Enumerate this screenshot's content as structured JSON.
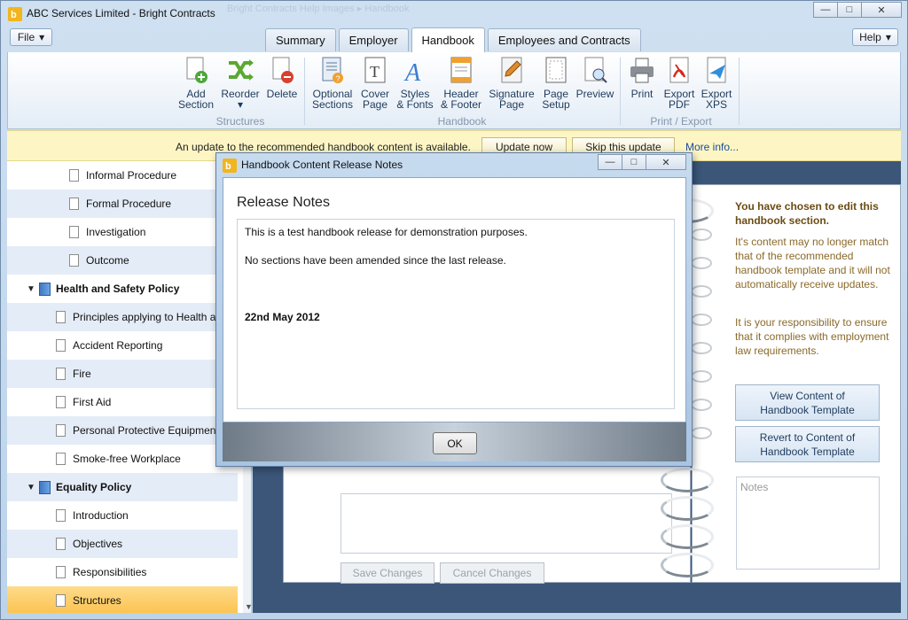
{
  "window": {
    "title": "ABC Services Limited - Bright Contracts",
    "ghost_text": "Bright Contracts Help Images  ▸  Handbook",
    "minimize": "—",
    "maximize": "□",
    "close": "✕"
  },
  "menubar": {
    "file_label": "File",
    "help_label": "Help",
    "dropdown_glyph": "▾"
  },
  "tabs": [
    {
      "label": "Summary",
      "active": false
    },
    {
      "label": "Employer",
      "active": false
    },
    {
      "label": "Handbook",
      "active": true
    },
    {
      "label": "Employees and Contracts",
      "active": false
    }
  ],
  "ribbon": {
    "structures": {
      "label": "Structures",
      "add_section": [
        "Add",
        "Section"
      ],
      "reorder": [
        "Reorder",
        "▾"
      ],
      "delete": "Delete"
    },
    "handbook": {
      "label": "Handbook",
      "optional_sections": [
        "Optional",
        "Sections"
      ],
      "cover_page": [
        "Cover",
        "Page"
      ],
      "styles_fonts": [
        "Styles",
        "& Fonts"
      ],
      "header_footer": [
        "Header",
        "& Footer"
      ],
      "signature_page": [
        "Signature",
        "Page"
      ],
      "page_setup": [
        "Page",
        "Setup"
      ],
      "preview": "Preview"
    },
    "print_export": {
      "label": "Print / Export",
      "print": "Print",
      "export_pdf": [
        "Export",
        "PDF"
      ],
      "export_xps": [
        "Export",
        "XPS"
      ]
    }
  },
  "notification": {
    "text": "An update to the recommended handbook content is available.",
    "update_now": "Update now",
    "skip_update": "Skip this update",
    "more_info": "More info..."
  },
  "sidebar": {
    "items": [
      {
        "label": "Informal Procedure",
        "level": 2
      },
      {
        "label": "Formal Procedure",
        "level": 2
      },
      {
        "label": "Investigation",
        "level": 2
      },
      {
        "label": "Outcome",
        "level": 2
      },
      {
        "label": "Health and Safety Policy",
        "level": 0
      },
      {
        "label": "Principles applying to Health and Safety",
        "level": 1
      },
      {
        "label": "Accident Reporting",
        "level": 1
      },
      {
        "label": "Fire",
        "level": 1
      },
      {
        "label": "First Aid",
        "level": 1
      },
      {
        "label": "Personal Protective Equipment",
        "level": 1
      },
      {
        "label": "Smoke-free Workplace",
        "level": 1
      },
      {
        "label": "Equality Policy",
        "level": 0
      },
      {
        "label": "Introduction",
        "level": 1
      },
      {
        "label": "Objectives",
        "level": 1
      },
      {
        "label": "Responsibilities",
        "level": 1
      },
      {
        "label": "Structures",
        "level": 1,
        "selected": true
      }
    ],
    "expand_glyph": "▼",
    "scroll_down_glyph": "▼"
  },
  "editor": {
    "save_changes": "Save Changes",
    "cancel_changes": "Cancel Changes"
  },
  "info_panel": {
    "heading": "You have chosen to edit this handbook section.",
    "para1": "It's content may no longer match that of the recommended handbook template and it will not automatically receive updates.",
    "para2": "It is your responsibility to ensure that it complies with employment law requirements.",
    "view_button": [
      "View Content of",
      "Handbook Template"
    ],
    "revert_button": [
      "Revert to Content of",
      "Handbook Template"
    ],
    "notes_placeholder": "Notes"
  },
  "dialog": {
    "title": "Handbook Content Release Notes",
    "heading": "Release Notes",
    "line1": "This is a test handbook release for demonstration purposes.",
    "line2": "No sections have been amended since the last release.",
    "date": "22nd May 2012",
    "ok": "OK"
  },
  "colors": {
    "accent": "#fbc24e",
    "brand": "#e8a317",
    "notification_bg": "#fdf6c4"
  }
}
